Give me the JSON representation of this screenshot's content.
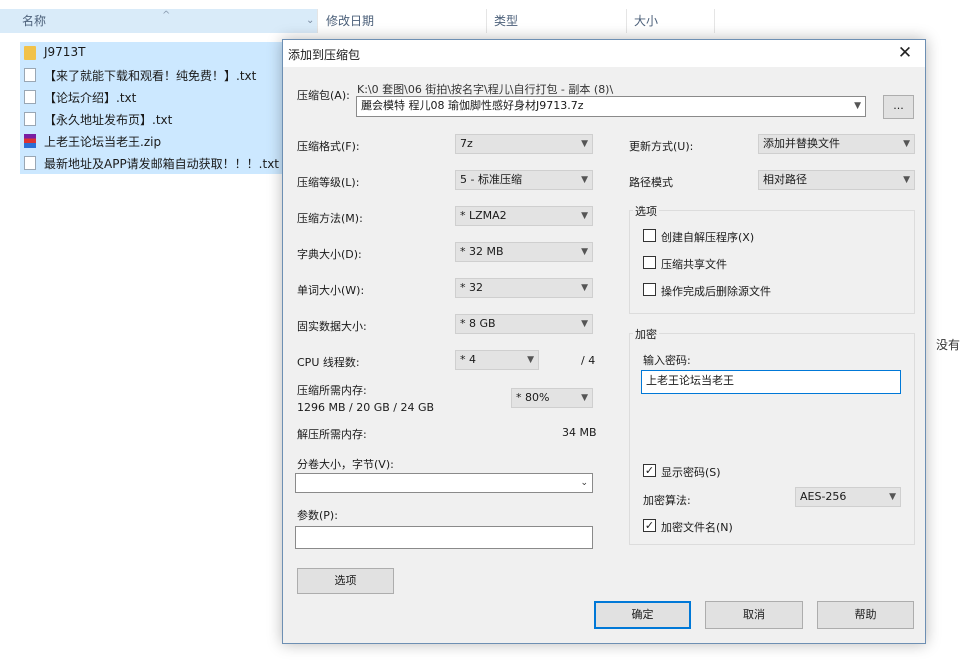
{
  "explorer": {
    "columns": {
      "name": "名称",
      "modified": "修改日期",
      "type": "类型",
      "size": "大小"
    },
    "sort_indicator": "^",
    "files": [
      {
        "name": "J9713T",
        "icon": "folder"
      },
      {
        "name": "【来了就能下载和观看！纯免费！】.txt",
        "icon": "txt"
      },
      {
        "name": "【论坛介绍】.txt",
        "icon": "txt"
      },
      {
        "name": "【永久地址发布页】.txt",
        "icon": "txt"
      },
      {
        "name": "上老王论坛当老王.zip",
        "icon": "zip"
      },
      {
        "name": "最新地址及APP请发邮箱自动获取！！！.txt",
        "icon": "txt"
      }
    ],
    "side_text": "没有"
  },
  "dialog": {
    "title": "添加到压缩包",
    "close_glyph": "✕",
    "archive_label": "压缩包(A):",
    "archive_path": "K:\\0 套图\\06 街拍\\按名字\\程儿\\自行打包 - 副本 (8)\\",
    "archive_name": "麗会模特 程儿08 瑜伽脚性感好身材J9713.7z",
    "browse_label": "...",
    "left": {
      "format_label": "压缩格式(F):",
      "format_value": "7z",
      "level_label": "压缩等级(L):",
      "level_value": "5 - 标准压缩",
      "method_label": "压缩方法(M):",
      "method_value": "* LZMA2",
      "dict_label": "字典大小(D):",
      "dict_value": "* 32 MB",
      "word_label": "单词大小(W):",
      "word_value": "* 32",
      "solid_label": "固实数据大小:",
      "solid_value": "* 8 GB",
      "threads_label": "CPU 线程数:",
      "threads_value": "* 4",
      "threads_total": "/ 4",
      "mem_comp_label": "压缩所需内存:",
      "mem_comp_detail": "1296 MB / 20 GB / 24 GB",
      "mem_comp_value": "* 80%",
      "mem_decomp_label": "解压所需内存:",
      "mem_decomp_value": "34 MB",
      "split_label": "分卷大小，字节(V):",
      "split_value": "",
      "params_label": "参数(P):",
      "params_value": "",
      "options_button": "选项"
    },
    "right": {
      "update_label": "更新方式(U):",
      "update_value": "添加并替换文件",
      "path_label": "路径模式",
      "path_value": "相对路径",
      "options_title": "选项",
      "opt_sfx": "创建自解压程序(X)",
      "opt_shared": "压缩共享文件",
      "opt_delete": "操作完成后删除源文件",
      "encrypt_title": "加密",
      "password_label": "输入密码:",
      "password_value": "上老王论坛当老王",
      "show_password": "显示密码(S)",
      "method_label": "加密算法:",
      "method_value": "AES-256",
      "encrypt_names": "加密文件名(N)",
      "check_glyph": "✓"
    },
    "buttons": {
      "ok": "确定",
      "cancel": "取消",
      "help": "帮助"
    }
  }
}
